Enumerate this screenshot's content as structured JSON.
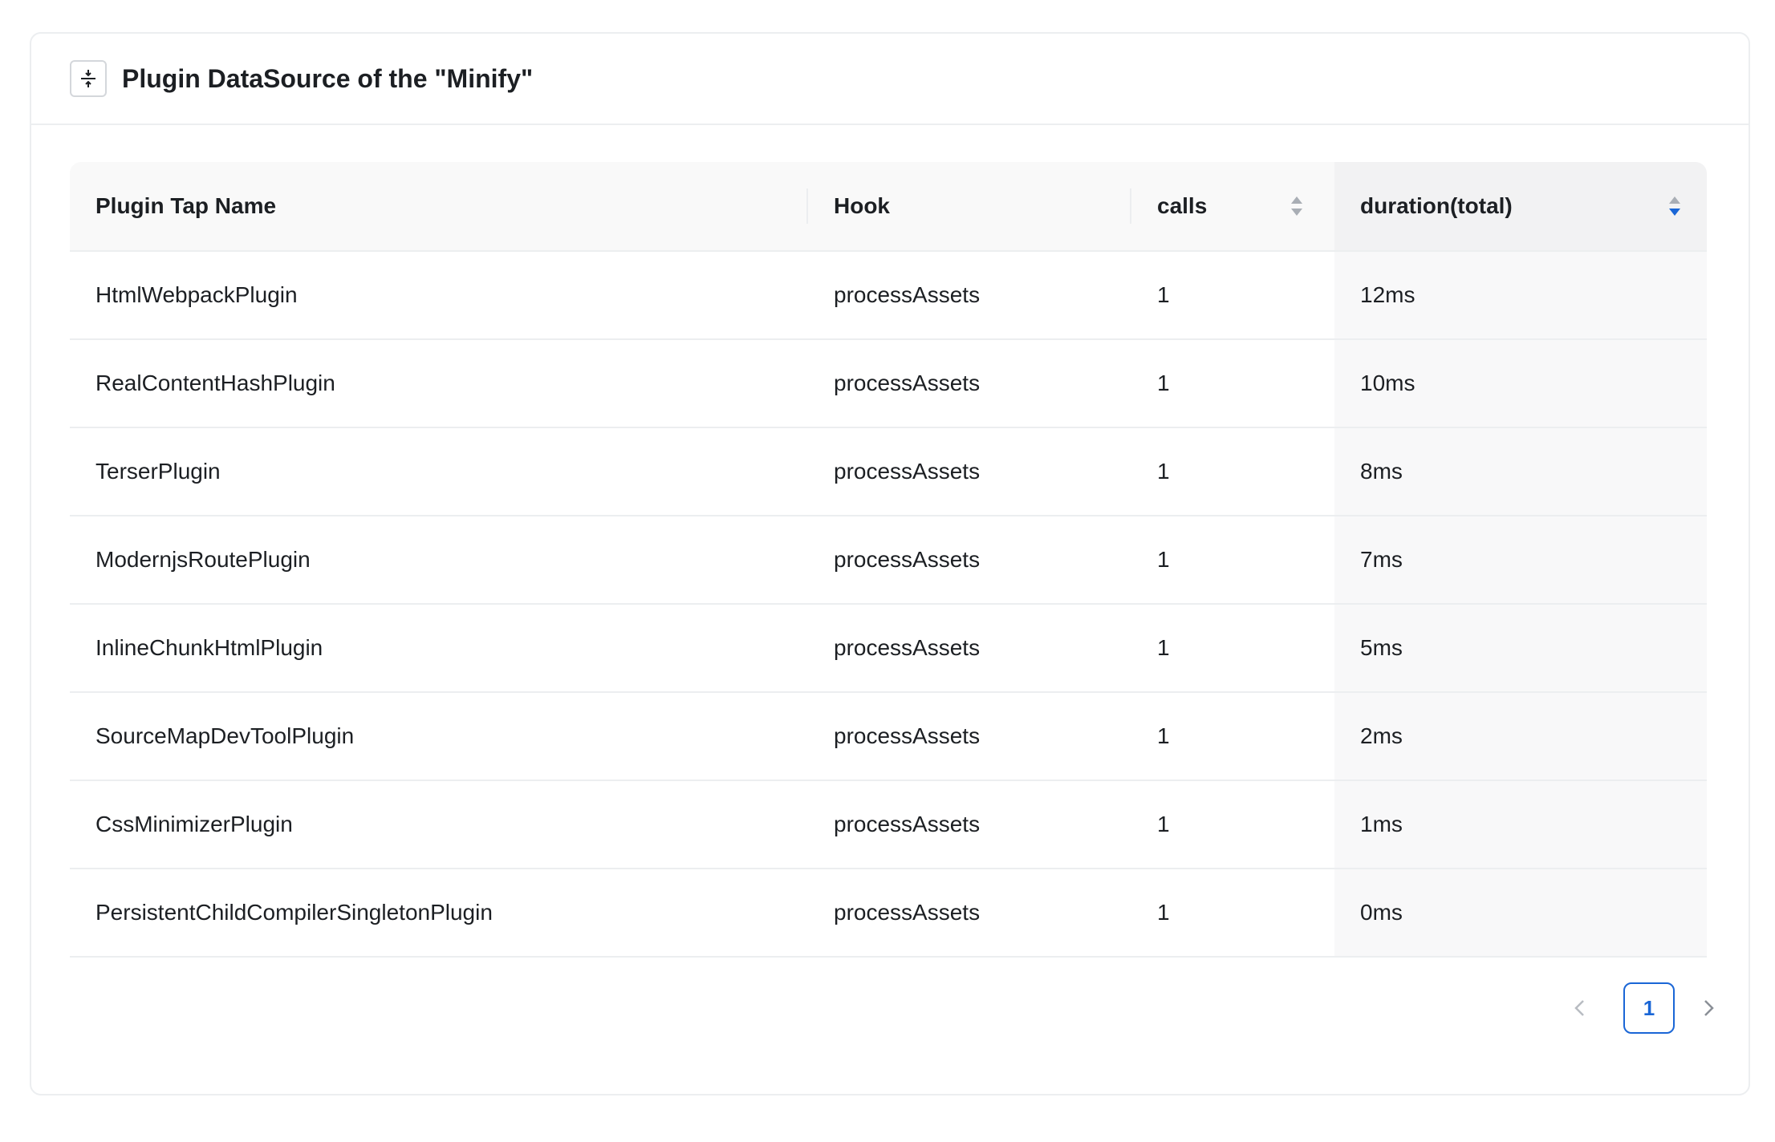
{
  "card": {
    "title": "Plugin DataSource of the \"Minify\"",
    "collapse_icon": "collapse-icon"
  },
  "table": {
    "columns": [
      {
        "label": "Plugin Tap Name",
        "sortable": false
      },
      {
        "label": "Hook",
        "sortable": false
      },
      {
        "label": "calls",
        "sortable": true,
        "sort_state": "none"
      },
      {
        "label": "duration(total)",
        "sortable": true,
        "sort_state": "descending"
      }
    ],
    "rows": [
      {
        "name": "HtmlWebpackPlugin",
        "hook": "processAssets",
        "calls": "1",
        "duration": "12ms"
      },
      {
        "name": "RealContentHashPlugin",
        "hook": "processAssets",
        "calls": "1",
        "duration": "10ms"
      },
      {
        "name": "TerserPlugin",
        "hook": "processAssets",
        "calls": "1",
        "duration": "8ms"
      },
      {
        "name": "ModernjsRoutePlugin",
        "hook": "processAssets",
        "calls": "1",
        "duration": "7ms"
      },
      {
        "name": "InlineChunkHtmlPlugin",
        "hook": "processAssets",
        "calls": "1",
        "duration": "5ms"
      },
      {
        "name": "SourceMapDevToolPlugin",
        "hook": "processAssets",
        "calls": "1",
        "duration": "2ms"
      },
      {
        "name": "CssMinimizerPlugin",
        "hook": "processAssets",
        "calls": "1",
        "duration": "1ms"
      },
      {
        "name": "PersistentChildCompilerSingletonPlugin",
        "hook": "processAssets",
        "calls": "1",
        "duration": "0ms"
      }
    ]
  },
  "pagination": {
    "current_page": "1",
    "prev_icon": "chevron-left-icon",
    "next_icon": "chevron-right-icon"
  },
  "colors": {
    "accent": "#1a66d6",
    "border": "#eceef0",
    "header_bg": "#f9f9f9",
    "sorted_column_bg": "#f8f8f9"
  }
}
